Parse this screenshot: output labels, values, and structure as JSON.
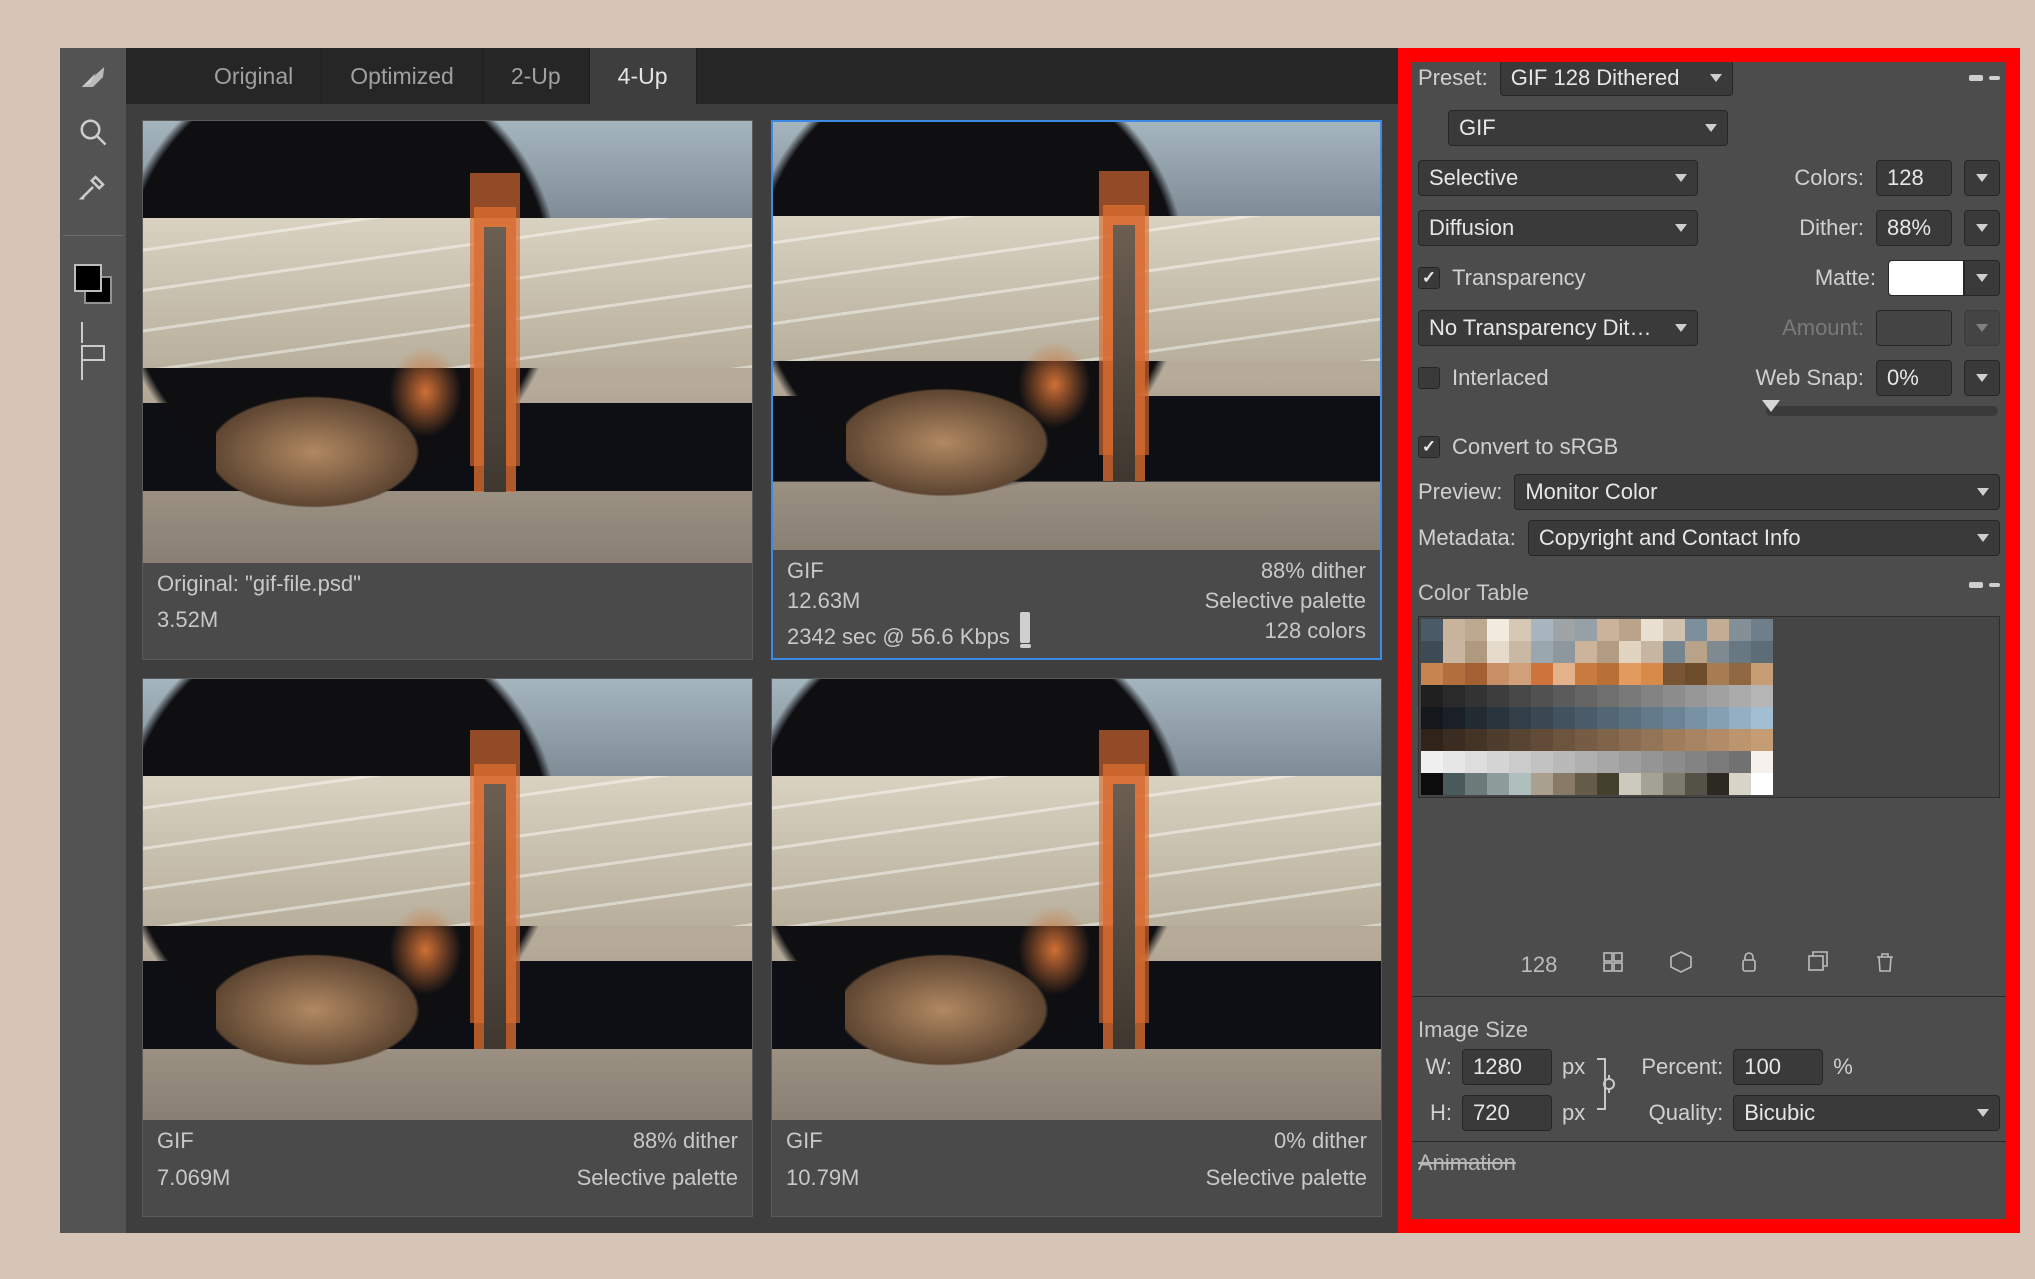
{
  "tabs": {
    "original": "Original",
    "optimized": "Optimized",
    "two_up": "2-Up",
    "four_up": "4-Up",
    "active": "4-Up"
  },
  "previews": [
    {
      "id": "p1",
      "selected": false,
      "l1": "Original: \"gif-file.psd\"",
      "r1": "",
      "l2": "3.52M",
      "r2": "",
      "l3": "",
      "r3": ""
    },
    {
      "id": "p2",
      "selected": true,
      "l1": "GIF",
      "r1": "88% dither",
      "l2": "12.63M",
      "r2": "Selective palette",
      "l3": "2342 sec @ 56.6 Kbps",
      "r3": "128 colors"
    },
    {
      "id": "p3",
      "selected": false,
      "l1": "GIF",
      "r1": "88% dither",
      "l2": "7.069M",
      "r2": "Selective palette",
      "l3": "",
      "r3": ""
    },
    {
      "id": "p4",
      "selected": false,
      "l1": "GIF",
      "r1": "0% dither",
      "l2": "10.79M",
      "r2": "Selective palette",
      "l3": "",
      "r3": ""
    }
  ],
  "panel": {
    "preset_label": "Preset:",
    "preset": "GIF 128 Dithered",
    "format": "GIF",
    "reduction": "Selective",
    "colors_label": "Colors:",
    "colors": "128",
    "dither_method": "Diffusion",
    "dither_label": "Dither:",
    "dither": "88%",
    "transparency": "Transparency",
    "matte_label": "Matte:",
    "trans_dither": "No Transparency Dit…",
    "amount_label": "Amount:",
    "interlaced": "Interlaced",
    "websnap_label": "Web Snap:",
    "websnap": "0%",
    "srgb": "Convert to sRGB",
    "preview_label": "Preview:",
    "preview": "Monitor Color",
    "metadata_label": "Metadata:",
    "metadata": "Copyright and Contact Info",
    "color_table": "Color Table",
    "ct_count": "128",
    "image_size": "Image Size",
    "w_label": "W:",
    "w": "1280",
    "h_label": "H:",
    "h": "720",
    "px": "px",
    "percent_label": "Percent:",
    "percent": "100",
    "pct_sign": "%",
    "quality_label": "Quality:",
    "quality": "Bicubic",
    "animation": "Animation"
  },
  "color_table_swatches": [
    "#4a5a66",
    "#c8b49c",
    "#bda98f",
    "#f1ebe0",
    "#d7c8b6",
    "#a7b6be",
    "#9fa4a7",
    "#96a0a7",
    "#cbb29a",
    "#b9a489",
    "#eae0d2",
    "#d1c2af",
    "#7d8f9c",
    "#c2ad93",
    "#849097",
    "#6f7f8a",
    "#3e4a54",
    "#cab6a0",
    "#af9a80",
    "#e6dbca",
    "#c9b9a4",
    "#9aa7af",
    "#8e979d",
    "#cbb49a",
    "#b19c82",
    "#e1d4c1",
    "#c6b5a0",
    "#74858f",
    "#b9a388",
    "#7e8990",
    "#677882",
    "#5d6d77",
    "#c6854f",
    "#b36e3d",
    "#a36033",
    "#c68f66",
    "#d1a079",
    "#ce743a",
    "#e3b28a",
    "#c97a3f",
    "#b97036",
    "#e39a5e",
    "#d88a4b",
    "#7a5533",
    "#6e4d2d",
    "#a77c53",
    "#8f6741",
    "#c79d74",
    "#202020",
    "#2a2a2a",
    "#333333",
    "#3d3d3d",
    "#474747",
    "#515151",
    "#5b5b5b",
    "#656565",
    "#6f6f6f",
    "#797979",
    "#838383",
    "#8d8d8d",
    "#979797",
    "#a1a1a1",
    "#ababab",
    "#b5b5b5",
    "#14181d",
    "#1a2026",
    "#222a32",
    "#2a343d",
    "#323e48",
    "#3a4853",
    "#42525e",
    "#4a5c69",
    "#526674",
    "#5a707f",
    "#627a8a",
    "#6a8495",
    "#7891a3",
    "#86a0b3",
    "#94afc3",
    "#a2bed3",
    "#30241a",
    "#3a2c20",
    "#443426",
    "#4e3c2c",
    "#584432",
    "#624c38",
    "#6c543e",
    "#765c44",
    "#80644a",
    "#8a6c50",
    "#947456",
    "#9e7c5c",
    "#a88462",
    "#b28c68",
    "#bc946e",
    "#c69c74",
    "#efefef",
    "#e6e6e6",
    "#dddddd",
    "#d4d4d4",
    "#cbcbcb",
    "#c2c2c2",
    "#b9b9b9",
    "#b0b0b0",
    "#a7a7a7",
    "#9e9e9e",
    "#959595",
    "#8c8c8c",
    "#838383",
    "#7a7a7a",
    "#717171",
    "#f6f2eb",
    "#0c0c0c",
    "#4a5a5a",
    "#6c7a7a",
    "#8e9c9c",
    "#b0bebe",
    "#aaa090",
    "#887a66",
    "#665a48",
    "#44402e",
    "#cccabe",
    "#a4a296",
    "#7c7a6e",
    "#545246",
    "#2c2a20",
    "#d8d4c8",
    "#ffffff"
  ]
}
